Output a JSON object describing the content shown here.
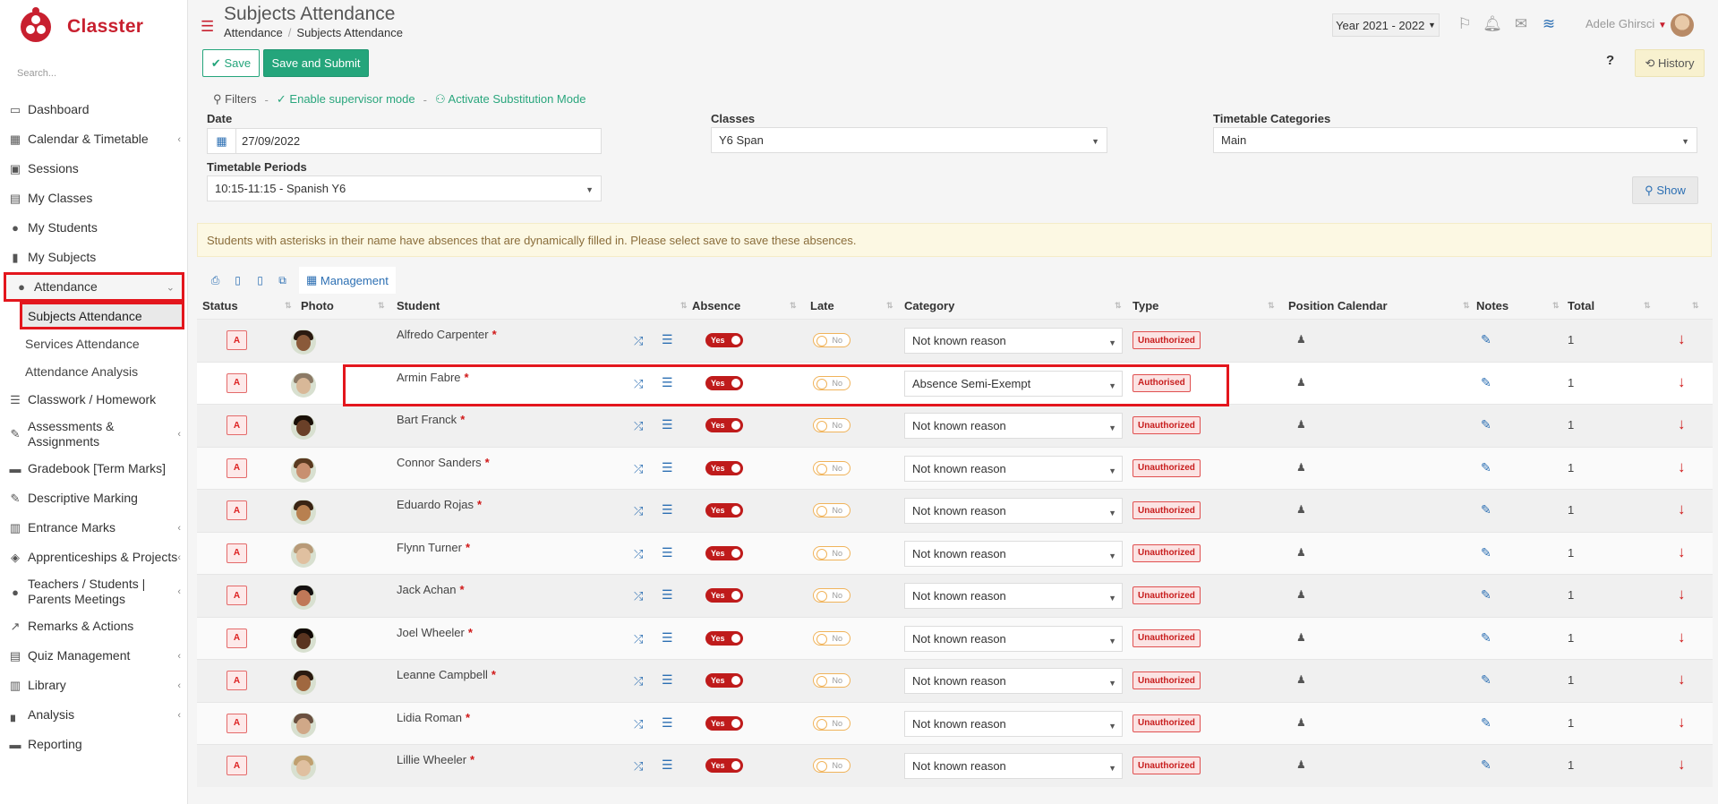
{
  "app": {
    "name": "Classter"
  },
  "sidebar": {
    "search_placeholder": "Search...",
    "items": [
      {
        "label": "Dashboard",
        "icon": "laptop-icon",
        "glyph": "▭"
      },
      {
        "label": "Calendar & Timetable",
        "icon": "calendar-icon",
        "glyph": "▦",
        "chevron": true
      },
      {
        "label": "Sessions",
        "icon": "sessions-icon",
        "glyph": "▣"
      },
      {
        "label": "My Classes",
        "icon": "classes-icon",
        "glyph": "▤"
      },
      {
        "label": "My Students",
        "icon": "students-icon",
        "glyph": "●"
      },
      {
        "label": "My Subjects",
        "icon": "book-icon",
        "glyph": "▮"
      }
    ],
    "attendance": {
      "label": "Attendance",
      "glyph": "●"
    },
    "sub_items": [
      "Subjects Attendance",
      "Services Attendance",
      "Attendance Analysis"
    ],
    "items_after": [
      {
        "label": "Classwork / Homework",
        "glyph": "☰"
      },
      {
        "label": "Assessments & Assignments",
        "glyph": "✎",
        "chevron": true,
        "two": true
      },
      {
        "label": "Gradebook [Term Marks]",
        "glyph": "▬"
      },
      {
        "label": "Descriptive Marking",
        "glyph": "✎"
      },
      {
        "label": "Entrance Marks",
        "glyph": "▥",
        "chevron": true
      },
      {
        "label": "Apprenticeships & Projects",
        "glyph": "◈",
        "chevron": true
      },
      {
        "label": "Teachers / Students | Parents Meetings",
        "glyph": "●",
        "chevron": true,
        "two": true
      },
      {
        "label": "Remarks & Actions",
        "glyph": "↗"
      },
      {
        "label": "Quiz Management",
        "glyph": "▤",
        "chevron": true
      },
      {
        "label": "Library",
        "glyph": "▥",
        "chevron": true
      },
      {
        "label": "Analysis",
        "glyph": "▖",
        "chevron": true
      },
      {
        "label": "Reporting",
        "glyph": "▬"
      }
    ]
  },
  "header": {
    "title": "Subjects Attendance",
    "breadcrumb": [
      "Attendance",
      "Subjects Attendance"
    ],
    "year": "Year 2021 - 2022",
    "user": "Adele Ghirsci"
  },
  "toolbar": {
    "save": "Save",
    "save_submit": "Save and Submit",
    "help": "?",
    "history": "History"
  },
  "filters": {
    "label": "Filters",
    "supervisor": "Enable supervisor mode",
    "substitution": "Activate Substitution Mode",
    "date_label": "Date",
    "date_value": "27/09/2022",
    "classes_label": "Classes",
    "classes_value": "Y6 Span",
    "categories_label": "Timetable Categories",
    "categories_value": "Main",
    "periods_label": "Timetable Periods",
    "periods_value": "10:15-11:15 - Spanish Y6",
    "show": "Show"
  },
  "notice": "Students with asterisks in their name have absences that are dynamically filled in. Please select save to save these absences.",
  "management": "Management",
  "table": {
    "columns": [
      "Status",
      "Photo",
      "Student",
      "Absence",
      "Late",
      "Category",
      "Type",
      "Position Calendar",
      "Notes",
      "Total"
    ],
    "rows": [
      {
        "status": "A",
        "name": "Alfredo Carpenter",
        "absence": "Yes",
        "late": "No",
        "category": "Not known reason",
        "type": "Unauthorized",
        "total": "1",
        "skin": "#8a5a3a",
        "hair": "#2a1a10"
      },
      {
        "status": "A",
        "name": "Armin Fabre",
        "absence": "Yes",
        "late": "No",
        "category": "Absence Semi-Exempt",
        "type": "Authorised",
        "total": "1",
        "skin": "#d8b898",
        "hair": "#8c7a66"
      },
      {
        "status": "A",
        "name": "Bart Franck",
        "absence": "Yes",
        "late": "No",
        "category": "Not known reason",
        "type": "Unauthorized",
        "total": "1",
        "skin": "#6a4028",
        "hair": "#1a1008"
      },
      {
        "status": "A",
        "name": "Connor Sanders",
        "absence": "Yes",
        "late": "No",
        "category": "Not known reason",
        "type": "Unauthorized",
        "total": "1",
        "skin": "#c89070",
        "hair": "#5a3a20"
      },
      {
        "status": "A",
        "name": "Eduardo Rojas",
        "absence": "Yes",
        "late": "No",
        "category": "Not known reason",
        "type": "Unauthorized",
        "total": "1",
        "skin": "#b88050",
        "hair": "#3a2414"
      },
      {
        "status": "A",
        "name": "Flynn Turner",
        "absence": "Yes",
        "late": "No",
        "category": "Not known reason",
        "type": "Unauthorized",
        "total": "1",
        "skin": "#e0c0a0",
        "hair": "#b89a78"
      },
      {
        "status": "A",
        "name": "Jack Achan",
        "absence": "Yes",
        "late": "No",
        "category": "Not known reason",
        "type": "Unauthorized",
        "total": "1",
        "skin": "#c07858",
        "hair": "#141010"
      },
      {
        "status": "A",
        "name": "Joel Wheeler",
        "absence": "Yes",
        "late": "No",
        "category": "Not known reason",
        "type": "Unauthorized",
        "total": "1",
        "skin": "#5a3420",
        "hair": "#120a06"
      },
      {
        "status": "A",
        "name": "Leanne Campbell",
        "absence": "Yes",
        "late": "No",
        "category": "Not known reason",
        "type": "Unauthorized",
        "total": "1",
        "skin": "#a06840",
        "hair": "#2a1a10"
      },
      {
        "status": "A",
        "name": "Lidia Roman",
        "absence": "Yes",
        "late": "No",
        "category": "Not known reason",
        "type": "Unauthorized",
        "total": "1",
        "skin": "#d0a888",
        "hair": "#6a5040"
      },
      {
        "status": "A",
        "name": "Lillie Wheeler",
        "absence": "Yes",
        "late": "No",
        "category": "Not known reason",
        "type": "Unauthorized",
        "total": "1",
        "skin": "#e0c0a0",
        "hair": "#c0a070"
      }
    ]
  },
  "colors": {
    "brand": "#c8202f",
    "accent_green": "#24a57b",
    "link_blue": "#2c6fb3",
    "highlight_red": "#e3161d"
  }
}
